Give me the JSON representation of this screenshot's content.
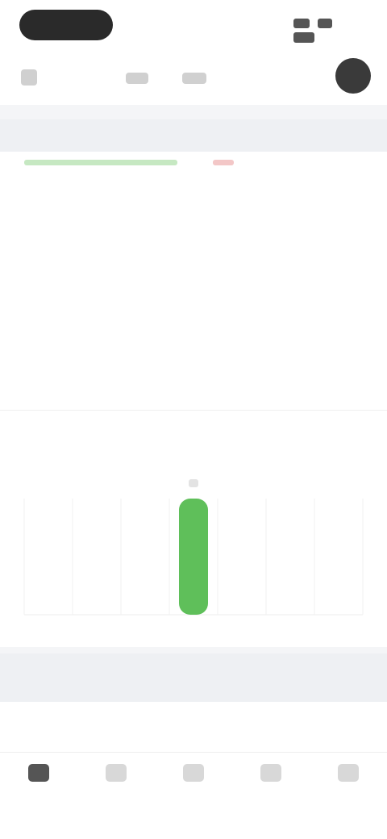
{
  "app": {
    "panel_title": "",
    "section2_title": ""
  },
  "book": {
    "left": [
      {
        "label": "",
        "sub": "",
        "value": ""
      },
      {
        "label": "",
        "sub": "",
        "value": ""
      },
      {
        "label": "",
        "sub": "",
        "value": ""
      },
      {
        "label": "",
        "sub": "",
        "value": ""
      }
    ],
    "right": [
      {
        "label": "",
        "sub": "",
        "value": ""
      },
      {
        "label": "",
        "sub": "",
        "value": ""
      },
      {
        "label": "",
        "sub": "",
        "value": ""
      }
    ]
  },
  "tabs": [
    {
      "label": ""
    },
    {
      "label": ""
    }
  ],
  "filters": [
    {
      "label": "",
      "sub": ""
    },
    {
      "label": ""
    },
    {
      "label": ""
    },
    {
      "label": ""
    }
  ],
  "bottom_nav": [
    {
      "label": "",
      "icon": "home-icon"
    },
    {
      "label": "",
      "icon": "markets-icon"
    },
    {
      "label": "",
      "icon": "trade-icon"
    },
    {
      "label": "",
      "icon": "futures-icon"
    },
    {
      "label": "",
      "icon": "wallet-icon"
    }
  ],
  "colors": {
    "bid": "#5fbf5a",
    "ask": "#e07a7a",
    "background": "#f4f5f7"
  },
  "chart_data": {
    "type": "bar",
    "title": "",
    "xlabel": "",
    "ylabel": "",
    "grid": true,
    "categories": [
      "",
      "",
      "",
      "",
      "",
      "",
      ""
    ],
    "values": [
      0,
      0,
      0,
      1,
      0,
      0,
      0
    ],
    "ylim": [
      0,
      1
    ]
  }
}
